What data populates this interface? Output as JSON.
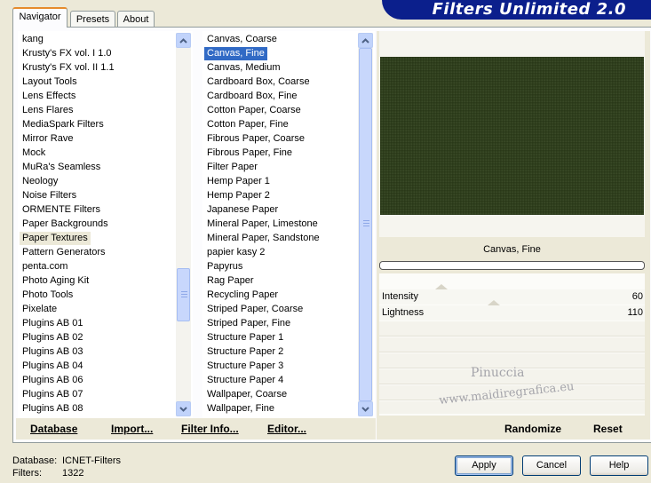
{
  "tabs": [
    "Navigator",
    "Presets",
    "About"
  ],
  "app_title": "Filters Unlimited 2.0",
  "categories": [
    "kang",
    "Krusty's FX vol. I 1.0",
    "Krusty's FX vol. II 1.1",
    "Layout Tools",
    "Lens Effects",
    "Lens Flares",
    "MediaSpark Filters",
    "Mirror Rave",
    "Mock",
    "MuRa's Seamless",
    "Neology",
    "Noise Filters",
    "ORMENTE Filters",
    "Paper Backgrounds",
    "Paper Textures",
    "Pattern Generators",
    "penta.com",
    "Photo Aging Kit",
    "Photo Tools",
    "Pixelate",
    "Plugins AB 01",
    "Plugins AB 02",
    "Plugins AB 03",
    "Plugins AB 04",
    "Plugins AB 06",
    "Plugins AB 07",
    "Plugins AB 08"
  ],
  "selected_category": "Paper Textures",
  "filters": [
    "Canvas, Coarse",
    "Canvas, Fine",
    "Canvas, Medium",
    "Cardboard Box, Coarse",
    "Cardboard Box, Fine",
    "Cotton Paper, Coarse",
    "Cotton Paper, Fine",
    "Fibrous Paper, Coarse",
    "Fibrous Paper, Fine",
    "Filter Paper",
    "Hemp Paper 1",
    "Hemp Paper 2",
    "Japanese Paper",
    "Mineral Paper, Limestone",
    "Mineral Paper, Sandstone",
    "papier kasy 2",
    "Papyrus",
    "Rag Paper",
    "Recycling Paper",
    "Striped Paper, Coarse",
    "Striped Paper, Fine",
    "Structure Paper 1",
    "Structure Paper 2",
    "Structure Paper 3",
    "Structure Paper 4",
    "Wallpaper, Coarse",
    "Wallpaper, Fine"
  ],
  "selected_filter": "Canvas, Fine",
  "left_buttons": {
    "database": "Database",
    "import": "Import...",
    "filter_info": "Filter Info...",
    "editor": "Editor..."
  },
  "preview": {
    "filter_name": "Canvas, Fine",
    "color": "#2f3f1c"
  },
  "parameters": [
    {
      "label": "Intensity",
      "value": "60",
      "level": 60
    },
    {
      "label": "Lightness",
      "value": "110",
      "level": 110
    }
  ],
  "right_buttons": {
    "randomize": "Randomize",
    "reset": "Reset"
  },
  "watermark": {
    "line1": "Pinuccia",
    "line2": "www.maidiregrafica.eu"
  },
  "status": {
    "database_label": "Database:",
    "database_value": "ICNET-Filters",
    "filters_label": "Filters:",
    "filters_value": "1322"
  },
  "dialog_buttons": {
    "apply": "Apply",
    "cancel": "Cancel",
    "help": "Help"
  }
}
